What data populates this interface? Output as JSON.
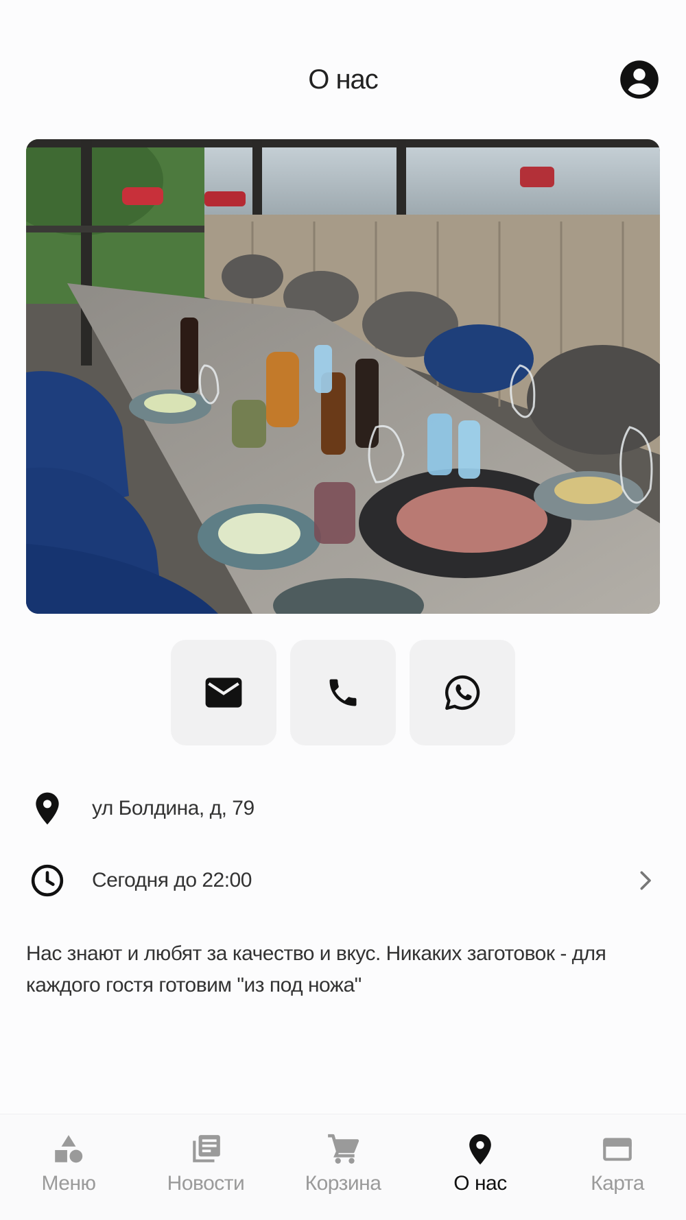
{
  "header": {
    "title": "О нас",
    "profile_icon": "account-circle-icon"
  },
  "hero": {
    "image": "restaurant-banquet-table-photo"
  },
  "contacts": [
    {
      "id": "email",
      "icon": "mail-icon"
    },
    {
      "id": "phone",
      "icon": "phone-icon"
    },
    {
      "id": "whatsapp",
      "icon": "whatsapp-icon"
    }
  ],
  "info": {
    "address": "ул Болдина, д, 79",
    "address_icon": "location-pin-icon",
    "hours": "Сегодня до 22:00",
    "hours_icon": "clock-icon"
  },
  "description": "Нас знают и любят за качество и вкус. Никаких заготовок - для каждого гостя готовим \"из под ножа\"",
  "tabbar": {
    "active": "about",
    "items": [
      {
        "id": "menu",
        "label": "Меню",
        "icon": "shapes-icon"
      },
      {
        "id": "news",
        "label": "Новости",
        "icon": "news-icon"
      },
      {
        "id": "cart",
        "label": "Корзина",
        "icon": "cart-icon"
      },
      {
        "id": "about",
        "label": "О нас",
        "icon": "location-pin-icon"
      },
      {
        "id": "card",
        "label": "Карта",
        "icon": "credit-card-icon"
      }
    ]
  },
  "colors": {
    "background": "#fcfcfd",
    "text": "#222222",
    "inactive_tab": "#9a9a9a",
    "button_bg": "#f1f1f2"
  }
}
